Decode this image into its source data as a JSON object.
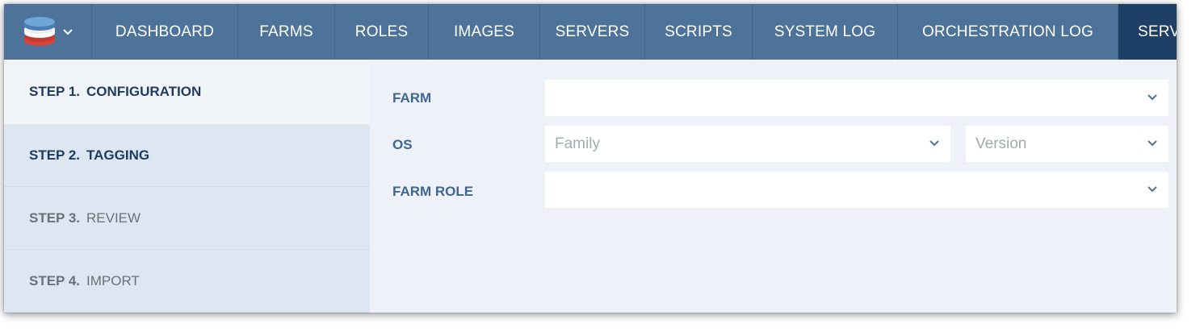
{
  "nav": {
    "items": [
      {
        "label": "DASHBOARD"
      },
      {
        "label": "FARMS"
      },
      {
        "label": "ROLES"
      },
      {
        "label": "IMAGES"
      },
      {
        "label": "SERVERS"
      },
      {
        "label": "SCRIPTS"
      },
      {
        "label": "SYSTEM LOG"
      },
      {
        "label": "ORCHESTRATION LOG"
      },
      {
        "label": "SERV"
      }
    ],
    "active_index": 8
  },
  "steps": [
    {
      "number": "STEP 1.",
      "label": "CONFIGURATION",
      "state": "current"
    },
    {
      "number": "STEP 2.",
      "label": "TAGGING",
      "state": "next"
    },
    {
      "number": "STEP 3.",
      "label": "REVIEW",
      "state": "future"
    },
    {
      "number": "STEP 4.",
      "label": "IMPORT",
      "state": "future"
    }
  ],
  "form": {
    "farm": {
      "label": "FARM",
      "value": ""
    },
    "os": {
      "label": "OS",
      "family_placeholder": "Family",
      "version_placeholder": "Version"
    },
    "farm_role": {
      "label": "FARM ROLE",
      "value": ""
    }
  },
  "colors": {
    "nav_bg": "#4d739b",
    "nav_active": "#1e3f66",
    "label_blue": "#3e6791",
    "sidebar_bg": "#dce7f1",
    "page_bg": "#eef2f8"
  }
}
